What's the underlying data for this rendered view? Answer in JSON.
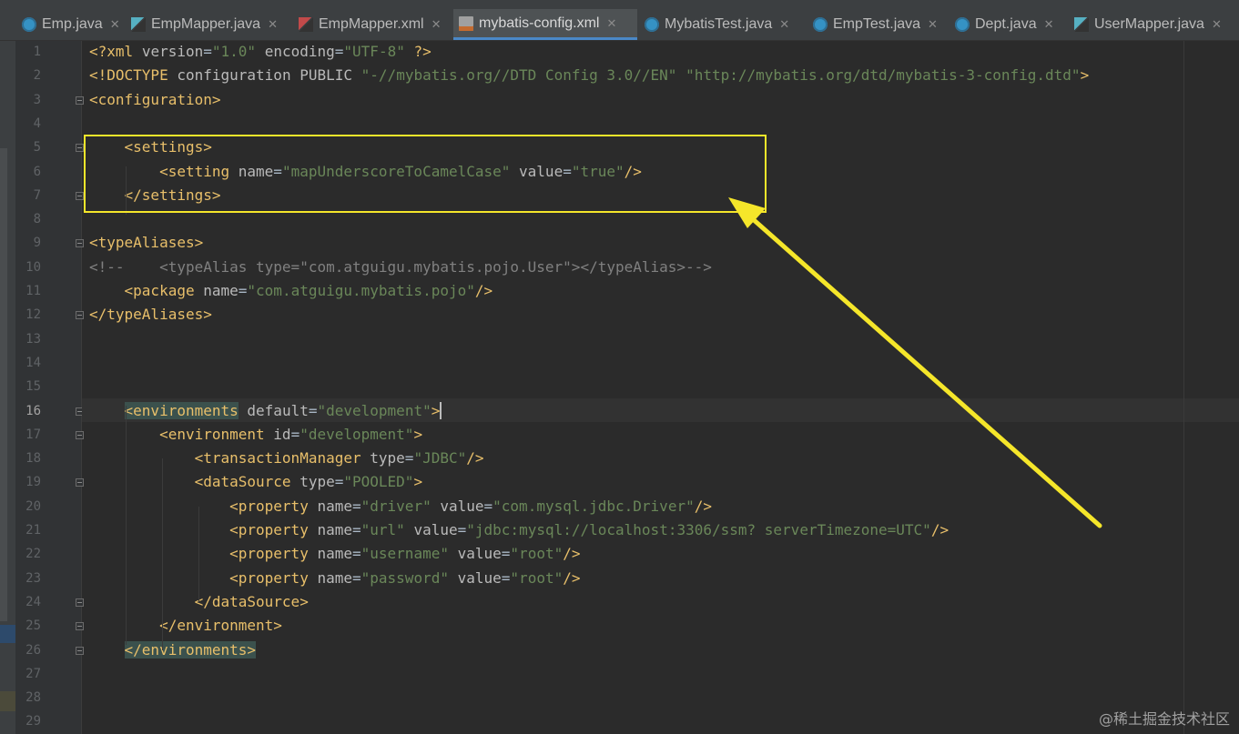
{
  "tabs": [
    {
      "label": "Emp.java",
      "icon": "java-class-icon",
      "active": false
    },
    {
      "label": "EmpMapper.java",
      "icon": "mapper-interface-icon",
      "active": false
    },
    {
      "label": "EmpMapper.xml",
      "icon": "mybatis-xml-icon",
      "active": false
    },
    {
      "label": "mybatis-config.xml",
      "icon": "xml-file-icon",
      "active": true
    },
    {
      "label": "MybatisTest.java",
      "icon": "java-class-icon",
      "active": false
    },
    {
      "label": "EmpTest.java",
      "icon": "java-class-icon",
      "active": false
    },
    {
      "label": "Dept.java",
      "icon": "java-class-icon",
      "active": false
    },
    {
      "label": "UserMapper.java",
      "icon": "mapper-interface-icon",
      "active": false
    }
  ],
  "editor": {
    "current_line": 16,
    "lines": [
      {
        "n": "1",
        "text": "<?xml version=\"1.0\" encoding=\"UTF-8\" ?>"
      },
      {
        "n": "2",
        "text": "<!DOCTYPE configuration PUBLIC \"-//mybatis.org//DTD Config 3.0//EN\" \"http://mybatis.org/dtd/mybatis-3-config.dtd\">"
      },
      {
        "n": "3",
        "text": "<configuration>"
      },
      {
        "n": "4",
        "text": ""
      },
      {
        "n": "5",
        "text": "    <settings>"
      },
      {
        "n": "6",
        "text": "        <setting name=\"mapUnderscoreToCamelCase\" value=\"true\"/>"
      },
      {
        "n": "7",
        "text": "    </settings>"
      },
      {
        "n": "8",
        "text": ""
      },
      {
        "n": "9",
        "text": "<typeAliases>"
      },
      {
        "n": "10",
        "text": "<!--    <typeAlias type=\"com.atguigu.mybatis.pojo.User\"></typeAlias>-->"
      },
      {
        "n": "11",
        "text": "    <package name=\"com.atguigu.mybatis.pojo\"/>"
      },
      {
        "n": "12",
        "text": "</typeAliases>"
      },
      {
        "n": "13",
        "text": ""
      },
      {
        "n": "14",
        "text": ""
      },
      {
        "n": "15",
        "text": ""
      },
      {
        "n": "16",
        "text": "    <environments default=\"development\">"
      },
      {
        "n": "17",
        "text": "        <environment id=\"development\">"
      },
      {
        "n": "18",
        "text": "            <transactionManager type=\"JDBC\"/>"
      },
      {
        "n": "19",
        "text": "            <dataSource type=\"POOLED\">"
      },
      {
        "n": "20",
        "text": "                <property name=\"driver\" value=\"com.mysql.jdbc.Driver\"/>"
      },
      {
        "n": "21",
        "text": "                <property name=\"url\" value=\"jdbc:mysql://localhost:3306/ssm? serverTimezone=UTC\"/>"
      },
      {
        "n": "22",
        "text": "                <property name=\"username\" value=\"root\"/>"
      },
      {
        "n": "23",
        "text": "                <property name=\"password\" value=\"root\"/>"
      },
      {
        "n": "24",
        "text": "            </dataSource>"
      },
      {
        "n": "25",
        "text": "        </environment>"
      },
      {
        "n": "26",
        "text": "    </environments>"
      },
      {
        "n": "27",
        "text": ""
      },
      {
        "n": "28",
        "text": ""
      },
      {
        "n": "29",
        "text": ""
      }
    ]
  },
  "annotation": {
    "color": "#f5e62a",
    "target": "settings block (lines 5-7)"
  },
  "watermark": "@稀土掘金技术社区"
}
